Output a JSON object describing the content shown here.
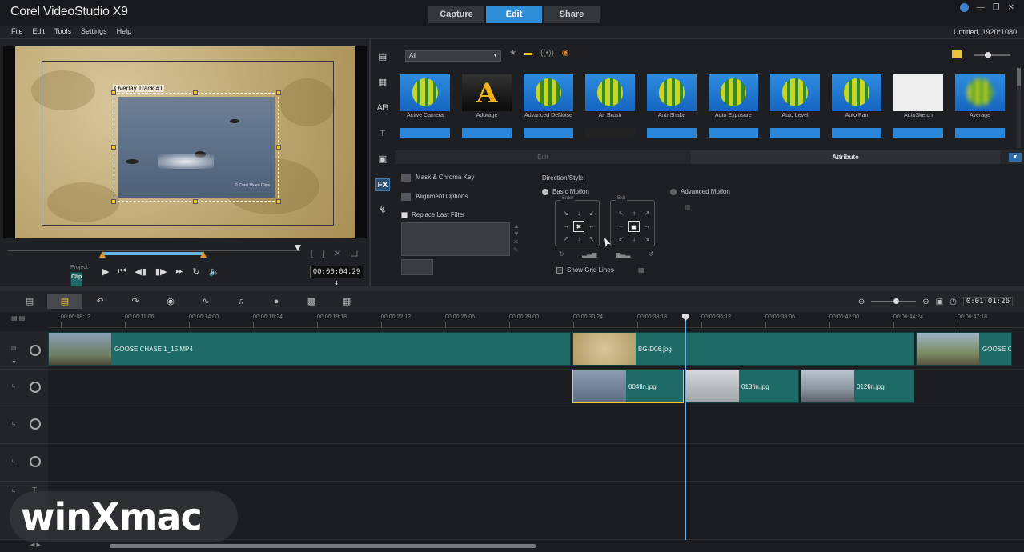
{
  "app": {
    "title": "Corel VideoStudio X9",
    "tabs": [
      {
        "label": "Capture",
        "active": false
      },
      {
        "label": "Edit",
        "active": true
      },
      {
        "label": "Share",
        "active": false
      }
    ],
    "project_info": "Untitled, 1920*1080",
    "accent_color": "#2f8fd6"
  },
  "menu": [
    "File",
    "Edit",
    "Tools",
    "Settings",
    "Help"
  ],
  "preview": {
    "overlay_label": "Overlay Track #1",
    "mode_project": "Project",
    "mode_clip": "Clip",
    "timecode": "00:00:04.29 ↕",
    "copyright": "© Corel Video Clips"
  },
  "library": {
    "category": "All",
    "filters": [
      {
        "label": "Active Camera",
        "style": "balloon"
      },
      {
        "label": "Adorage",
        "style": "dark"
      },
      {
        "label": "Advanced DeNoise",
        "style": "balloon"
      },
      {
        "label": "Air Brush",
        "style": "balloon"
      },
      {
        "label": "Anti-Shake",
        "style": "balloon"
      },
      {
        "label": "Auto Exposure",
        "style": "balloon"
      },
      {
        "label": "Auto Level",
        "style": "balloon"
      },
      {
        "label": "Auto Pan",
        "style": "balloon"
      },
      {
        "label": "AutoSketch",
        "style": "white"
      },
      {
        "label": "Average",
        "style": "blur"
      }
    ]
  },
  "options": {
    "tab_edit": "Edit",
    "tab_attribute": "Attribute",
    "mask_chroma": "Mask & Chroma Key",
    "alignment": "Alignment Options",
    "replace_filter": "Replace Last Filter",
    "direction_style": "Direction/Style:",
    "basic_motion": "Basic Motion",
    "advanced_motion": "Advanced Motion",
    "enter": "Enter",
    "exit": "Exit",
    "show_grid": "Show Grid Lines"
  },
  "timeline": {
    "timecode": "0:01:01:26",
    "ruler": [
      "00:00:08:12",
      "00:00:11:06",
      "00:00:14:00",
      "00:00:16:24",
      "00:00:19:18",
      "00:00:22:12",
      "00:00:25:06",
      "00:00:28:00",
      "00:00:30:24",
      "00:00:33:18",
      "00:00:36:12",
      "00:00:39:06",
      "00:00:42:00",
      "00:00:44:24",
      "00:00:47:18"
    ],
    "video_track": [
      {
        "name": "GOOSE CHASE 1_15.MP4"
      },
      {
        "name": "BG-D06.jpg"
      },
      {
        "name": "GOOSE C"
      }
    ],
    "overlay_track": [
      {
        "name": "004fin.jpg"
      },
      {
        "name": "013fin.jpg"
      },
      {
        "name": "012fin.jpg"
      }
    ]
  },
  "watermark": "winXmac"
}
